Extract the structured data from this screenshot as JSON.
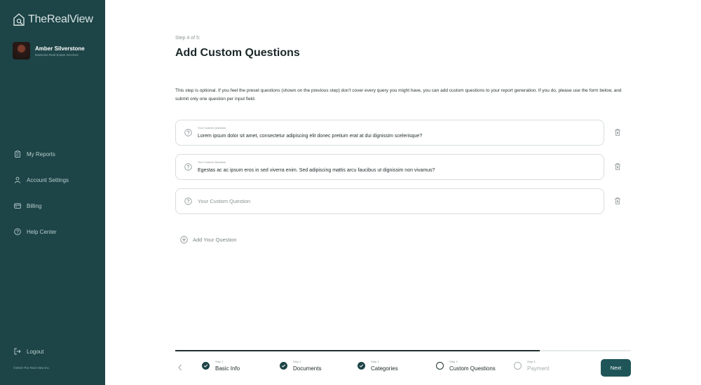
{
  "app": {
    "logo_text": "TheRealView"
  },
  "profile": {
    "name": "Amber Silverstone",
    "company": "Dawnrise Real Estate Services"
  },
  "nav": {
    "items": [
      {
        "label": "My Reports",
        "icon": "clipboard-icon"
      },
      {
        "label": "Account Settings",
        "icon": "user-icon"
      },
      {
        "label": "Billing",
        "icon": "card-icon"
      },
      {
        "label": "Help Center",
        "icon": "help-icon"
      }
    ],
    "logout": "Logout",
    "copyright": "©2023 The Real View Inc."
  },
  "main": {
    "step_label": "Step 4 of 5:",
    "title": "Add Custom Questions",
    "intro": "This step is optional. If you feel the preset questions (shown on the previous step) don't cover every query you might have, you can add custom questions to your report generation. If you do, please use the form below, and submit only one question per input field.",
    "questions": [
      {
        "caption": "Your Custom Question",
        "value": "Lorem ipsum dolor sit amet, consectetur adipiscing elit donec pretium erat at dui dignissim scelerisque?"
      },
      {
        "caption": "Your Custom Question",
        "value": "Egestas ac ac ipsum eros in sed viverra enim. Sed adipiscing mattis arcu faucibus ut dignissim non vivamus?"
      },
      {
        "placeholder": "Your Custom Question"
      }
    ],
    "add_question": "Add Your Question"
  },
  "stepper": {
    "progress": 0.8,
    "steps": [
      {
        "small": "Step 1",
        "name": "Basic Info",
        "state": "done"
      },
      {
        "small": "Step 2",
        "name": "Documents",
        "state": "done"
      },
      {
        "small": "Step 3",
        "name": "Categories",
        "state": "done"
      },
      {
        "small": "Step 4",
        "name": "Custom Questions",
        "state": "current"
      },
      {
        "small": "Step 4",
        "name": "Payment",
        "state": "todo"
      }
    ],
    "next_label": "Next"
  },
  "colors": {
    "sidebar": "#1d4447",
    "accent": "#1f5558"
  }
}
